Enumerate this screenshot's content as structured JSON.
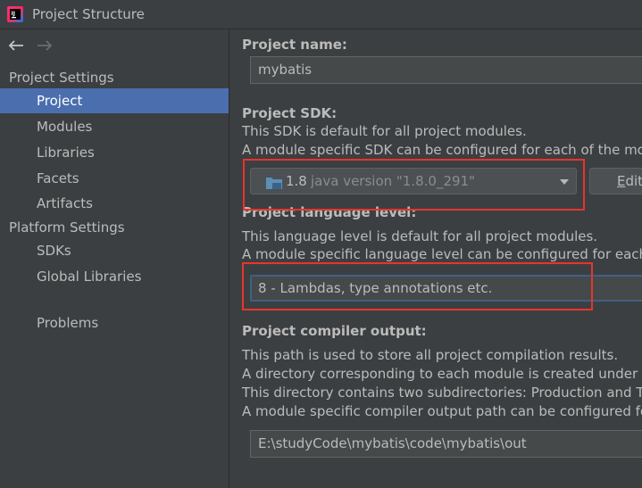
{
  "window": {
    "title": "Project Structure"
  },
  "sidebar": {
    "project_settings_label": "Project Settings",
    "project_settings_items": [
      {
        "label": "Project",
        "selected": true
      },
      {
        "label": "Modules",
        "selected": false
      },
      {
        "label": "Libraries",
        "selected": false
      },
      {
        "label": "Facets",
        "selected": false
      },
      {
        "label": "Artifacts",
        "selected": false
      }
    ],
    "platform_settings_label": "Platform Settings",
    "platform_settings_items": [
      {
        "label": "SDKs"
      },
      {
        "label": "Global Libraries"
      }
    ],
    "problems_label": "Problems"
  },
  "project": {
    "name_label": "Project name:",
    "name_value": "mybatis",
    "sdk_label": "Project SDK:",
    "sdk_desc_1": "This SDK is default for all project modules.",
    "sdk_desc_2": "A module specific SDK can be configured for each of the modu",
    "sdk_version": "1.8",
    "sdk_detail": "java version \"1.8.0_291\"",
    "edit_label_u": "E",
    "edit_label_rest": "dit",
    "lang_label": "Project language level:",
    "lang_desc_1": "This language level is default for all project modules.",
    "lang_desc_2": "A module specific language level can be configured for each o",
    "lang_value": "8 - Lambdas, type annotations etc.",
    "output_label": "Project compiler output:",
    "output_desc_1": "This path is used to store all project compilation results.",
    "output_desc_2": "A directory corresponding to each module is created under th",
    "output_desc_3": "This directory contains two subdirectories: Production and Te",
    "output_desc_4": "A module specific compiler output path can be configured for",
    "output_path": "E:\\studyCode\\mybatis\\code\\mybatis\\out"
  },
  "colors": {
    "background": "#3c3f41",
    "selection": "#4b6eaf",
    "highlight_box": "#e8342e",
    "text": "#bbbbbb"
  },
  "icons": [
    "intellij-idea-app-icon",
    "back-arrow-icon",
    "forward-arrow-icon",
    "folder-sdk-icon",
    "chevron-down-icon"
  ]
}
